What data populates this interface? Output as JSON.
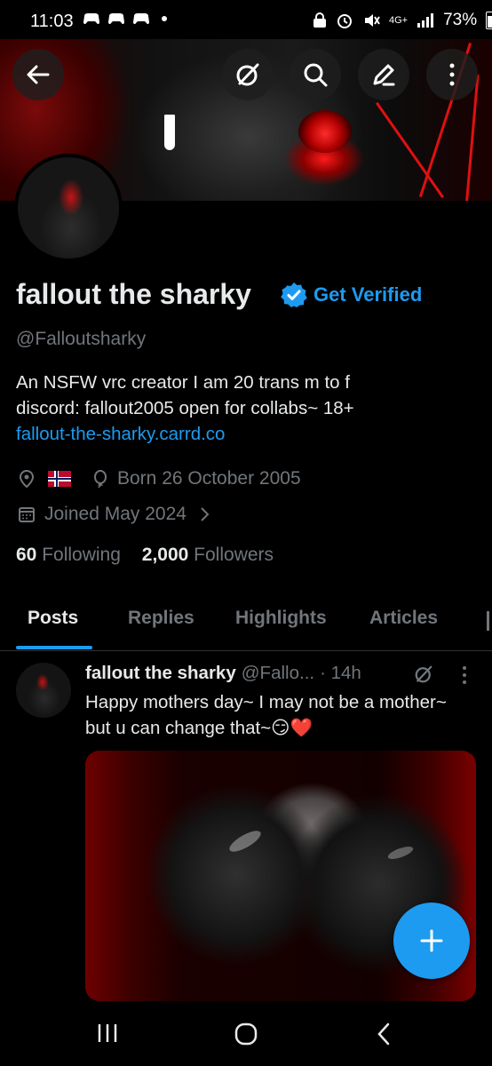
{
  "status_bar": {
    "time": "11:03",
    "network": "4G+",
    "battery": "73%"
  },
  "header": {
    "back_icon": "arrow-left-icon",
    "actions": [
      "grok-icon",
      "search-icon",
      "compose-icon",
      "more-vertical-icon"
    ]
  },
  "profile": {
    "name": "fallout the sharky",
    "get_verified": "Get Verified",
    "handle": "@Falloutsharky",
    "bio_line1": "An NSFW vrc creator I am 20 trans m to f",
    "bio_line2": "discord: fallout2005  open for collabs~ 18+",
    "bio_link": "fallout-the-sharky.carrd.co",
    "born": "Born 26 October 2005",
    "joined": "Joined May 2024",
    "following_count": "60",
    "following_label": "Following",
    "followers_count": "2,000",
    "followers_label": "Followers"
  },
  "tabs": [
    {
      "label": "Posts",
      "active": true
    },
    {
      "label": "Replies"
    },
    {
      "label": "Highlights"
    },
    {
      "label": "Articles"
    }
  ],
  "post": {
    "author_name": "fallout the sharky",
    "author_handle": "@Fallo...",
    "time": "· 14h",
    "text": "Happy mothers day~ I may not be a mother~ but u can change that~😏❤️"
  },
  "colors": {
    "accent": "#1d9bf0",
    "text_primary": "#e7e9ea",
    "text_secondary": "#71767b",
    "background": "#000000"
  }
}
